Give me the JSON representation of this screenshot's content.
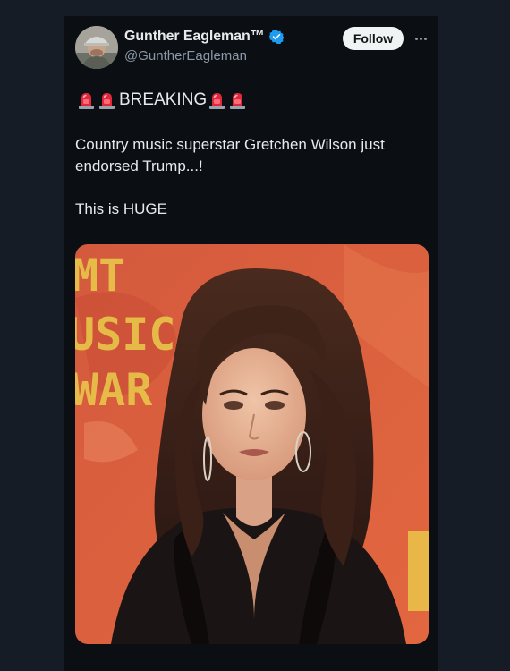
{
  "tweet": {
    "author": {
      "display_name": "Gunther Eagleman™",
      "handle": "@GuntherEagleman",
      "verified": true,
      "avatar_icon": "avatar-photo"
    },
    "follow_label": "Follow",
    "more_icon": "more-horizontal-icon",
    "breaking": {
      "emoji_icon": "police-car-light-icon",
      "label": "BREAKING"
    },
    "body": {
      "line1": "Country music superstar Gretchen Wilson just endorsed Trump...!",
      "line2": "This is HUGE"
    },
    "media": {
      "backdrop_text": [
        "MT",
        "USIC",
        "WAR"
      ],
      "kind": "photo"
    }
  },
  "colors": {
    "page_bg": "#151c25",
    "card_bg": "#0b0f14",
    "text_primary": "#e7e9ea",
    "text_secondary": "#8b98a5",
    "verified_blue": "#1d9bf0",
    "backdrop_orange": "#d9593a",
    "backdrop_text_yellow": "#e9c64a"
  }
}
